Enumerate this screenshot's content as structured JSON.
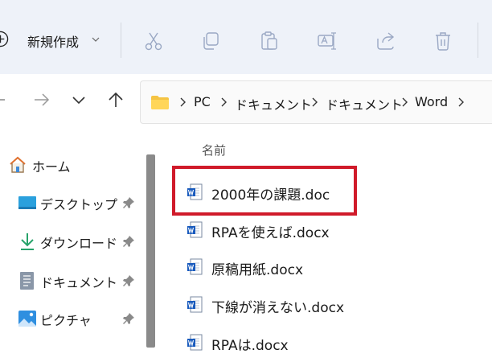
{
  "toolbar": {
    "new_label": "新規作成",
    "icons": [
      "cut-icon",
      "copy-icon",
      "paste-icon",
      "rename-icon",
      "share-icon",
      "delete-icon"
    ]
  },
  "address": {
    "crumbs": [
      "PC",
      "ドキュメント",
      "ドキュメント",
      "Word"
    ]
  },
  "sidebar": {
    "items": [
      {
        "label": "ホーム",
        "icon": "home-icon",
        "pinned": false
      },
      {
        "label": "デスクトップ",
        "icon": "desktop-icon",
        "pinned": true
      },
      {
        "label": "ダウンロード",
        "icon": "download-icon",
        "pinned": true
      },
      {
        "label": "ドキュメント",
        "icon": "documents-icon",
        "pinned": true
      },
      {
        "label": "ピクチャ",
        "icon": "pictures-icon",
        "pinned": true
      }
    ]
  },
  "content": {
    "column_header": "名前",
    "files": [
      {
        "name": "2000年の課題.doc",
        "highlighted": true
      },
      {
        "name": "RPAを使えば.docx",
        "highlighted": false
      },
      {
        "name": "原稿用紙.docx",
        "highlighted": false
      },
      {
        "name": "下線が消えない.docx",
        "highlighted": false
      },
      {
        "name": "RPAは.docx",
        "highlighted": false
      }
    ]
  },
  "colors": {
    "accent": "#0067c0",
    "highlight": "#d01a2a",
    "word_blue": "#185abd"
  }
}
